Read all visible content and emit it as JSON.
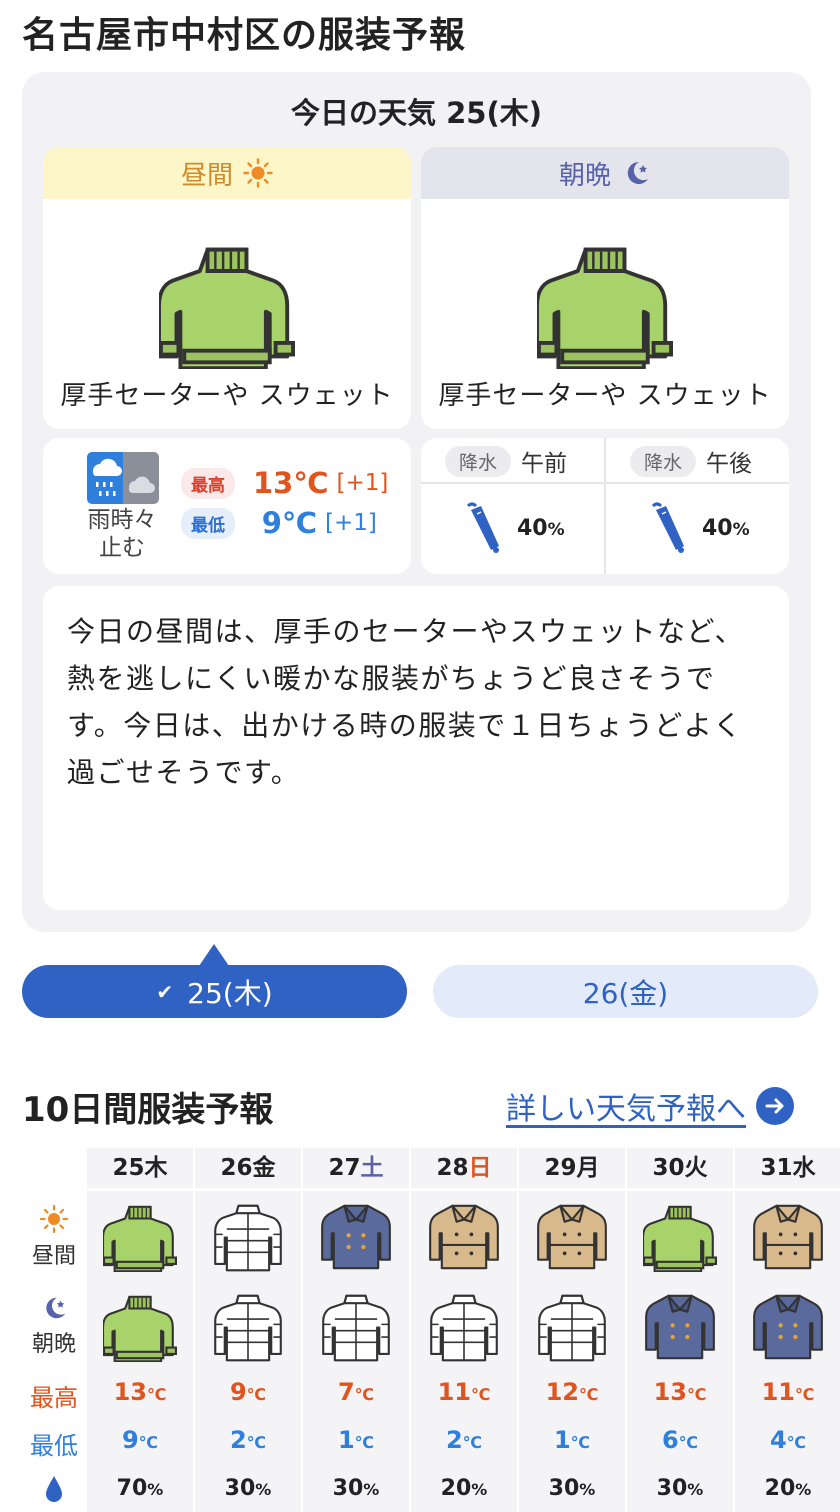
{
  "page": {
    "title": "名古屋市中村区の服装予報"
  },
  "today": {
    "heading": "今日の天気 25(木)",
    "day": {
      "label": "昼間",
      "cloth": "厚手セーターや スウェット",
      "icon": "sun-icon"
    },
    "night": {
      "label": "朝晩",
      "cloth": "厚手セーターや スウェット",
      "icon": "moon-icon"
    },
    "weather": {
      "label_line1": "雨時々",
      "label_line2": "止む",
      "icon": "rain-then-cloud-icon"
    },
    "high": {
      "tag": "最高",
      "value": "13℃",
      "diff": "[+1]"
    },
    "low": {
      "tag": "最低",
      "value": "9℃",
      "diff": "[+1]"
    },
    "rain": {
      "am": {
        "tag": "降水",
        "time": "午前",
        "value": "40",
        "unit": "%"
      },
      "pm": {
        "tag": "降水",
        "time": "午後",
        "value": "40",
        "unit": "%"
      }
    },
    "comment": "今日の昼間は、厚手のセーターやスウェットなど、熱を逃しにくい暖かな服装がちょうど良さそうです。今日は、出かける時の服装で１日ちょうどよく過ごせそうです。"
  },
  "date_tabs": [
    {
      "label": "25(木)",
      "active": true
    },
    {
      "label": "26(金)",
      "active": false
    }
  ],
  "tenday": {
    "title": "10日間服装予報",
    "link": "詳しい天気予報へ",
    "row_labels": {
      "day": "昼間",
      "night": "朝晩",
      "high": "最高",
      "low": "最低"
    },
    "days": [
      {
        "date": "25",
        "dow": "木",
        "dow_type": "weekday",
        "day_cloth": "sweater",
        "night_cloth": "sweater",
        "high": "13",
        "low": "9",
        "rain": "70"
      },
      {
        "date": "26",
        "dow": "金",
        "dow_type": "weekday",
        "day_cloth": "down-jacket",
        "night_cloth": "down-jacket",
        "high": "9",
        "low": "2",
        "rain": "30"
      },
      {
        "date": "27",
        "dow": "土",
        "dow_type": "saturday",
        "day_cloth": "pea-coat",
        "night_cloth": "down-jacket",
        "high": "7",
        "low": "1",
        "rain": "30"
      },
      {
        "date": "28",
        "dow": "日",
        "dow_type": "sunday",
        "day_cloth": "trench-coat",
        "night_cloth": "down-jacket",
        "high": "11",
        "low": "2",
        "rain": "20"
      },
      {
        "date": "29",
        "dow": "月",
        "dow_type": "weekday",
        "day_cloth": "trench-coat",
        "night_cloth": "down-jacket",
        "high": "12",
        "low": "1",
        "rain": "30"
      },
      {
        "date": "30",
        "dow": "火",
        "dow_type": "weekday",
        "day_cloth": "sweater",
        "night_cloth": "pea-coat",
        "high": "13",
        "low": "6",
        "rain": "30"
      },
      {
        "date": "31",
        "dow": "水",
        "dow_type": "weekday",
        "day_cloth": "trench-coat",
        "night_cloth": "pea-coat",
        "high": "11",
        "low": "4",
        "rain": "20"
      }
    ],
    "temp_unit": "℃",
    "rain_unit": "%"
  },
  "colors": {
    "accent": "#2f62c2",
    "high": "#e0541e",
    "low": "#2f7fdc",
    "sweater": "#a8d26a",
    "trench": "#d8b98c",
    "pea": "#5b6a9c"
  }
}
